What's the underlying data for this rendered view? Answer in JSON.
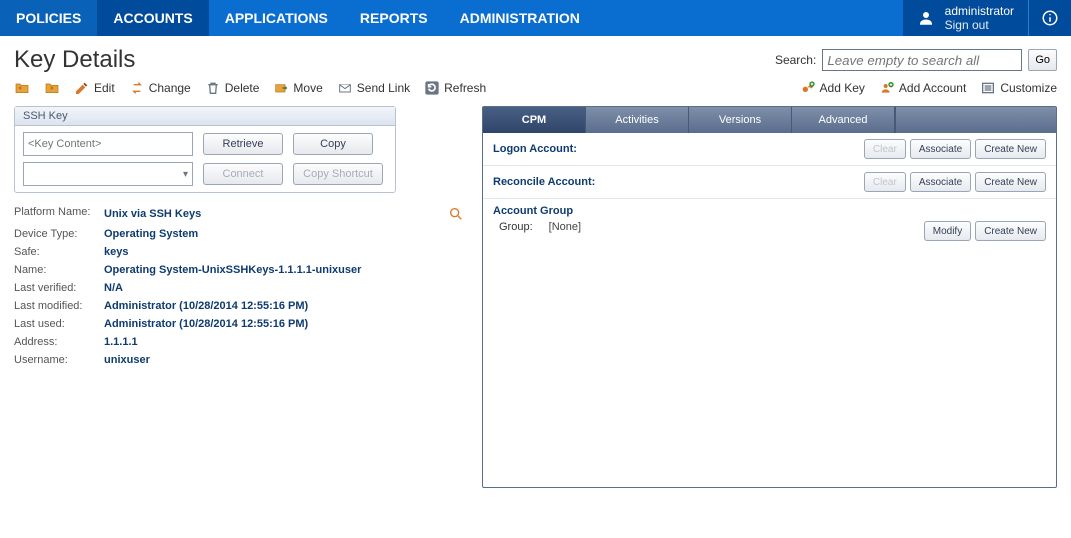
{
  "nav": {
    "items": [
      "POLICIES",
      "ACCOUNTS",
      "APPLICATIONS",
      "REPORTS",
      "ADMINISTRATION"
    ],
    "active_index": 1
  },
  "user": {
    "name": "administrator",
    "signout": "Sign out"
  },
  "page_title": "Key Details",
  "search": {
    "label": "Search:",
    "placeholder": "Leave empty to search all",
    "go": "Go"
  },
  "toolbar_left": [
    {
      "icon": "folder-arrow-left-icon",
      "label": ""
    },
    {
      "icon": "folder-arrow-right-icon",
      "label": ""
    },
    {
      "icon": "pencil-icon",
      "label": "Edit"
    },
    {
      "icon": "swap-icon",
      "label": "Change"
    },
    {
      "icon": "trash-icon",
      "label": "Delete"
    },
    {
      "icon": "move-icon",
      "label": "Move"
    },
    {
      "icon": "mail-icon",
      "label": "Send Link"
    },
    {
      "icon": "refresh-icon",
      "label": "Refresh"
    }
  ],
  "toolbar_right": [
    {
      "icon": "key-plus-icon",
      "label": "Add Key"
    },
    {
      "icon": "user-plus-icon",
      "label": "Add Account"
    },
    {
      "icon": "list-icon",
      "label": "Customize"
    }
  ],
  "ssh_panel": {
    "title": "SSH Key",
    "key_placeholder": "<Key Content>",
    "retrieve": "Retrieve",
    "copy": "Copy",
    "connect": "Connect",
    "copy_shortcut": "Copy Shortcut"
  },
  "details": [
    {
      "label": "Platform Name:",
      "value": "Unix via SSH Keys",
      "mag": true
    },
    {
      "label": "Device Type:",
      "value": "Operating System"
    },
    {
      "label": "Safe:",
      "value": "keys"
    },
    {
      "label": "Name:",
      "value": "Operating System-UnixSSHKeys-1.1.1.1-unixuser"
    },
    {
      "label": "Last verified:",
      "value": "N/A"
    },
    {
      "label": "Last modified:",
      "value": "Administrator (10/28/2014 12:55:16 PM)"
    },
    {
      "label": "Last used:",
      "value": "Administrator (10/28/2014 12:55:16 PM)"
    },
    {
      "label": "Address:",
      "value": "1.1.1.1"
    },
    {
      "label": "Username:",
      "value": "unixuser"
    }
  ],
  "tabs": {
    "items": [
      "CPM",
      "Activities",
      "Versions",
      "Advanced"
    ],
    "active_index": 0
  },
  "cpm": {
    "logon": {
      "label": "Logon Account:",
      "clear": "Clear",
      "associate": "Associate",
      "create": "Create New"
    },
    "reconcile": {
      "label": "Reconcile Account:",
      "clear": "Clear",
      "associate": "Associate",
      "create": "Create New"
    },
    "group": {
      "title": "Account Group",
      "label": "Group:",
      "value": "[None]",
      "modify": "Modify",
      "create": "Create New"
    }
  }
}
